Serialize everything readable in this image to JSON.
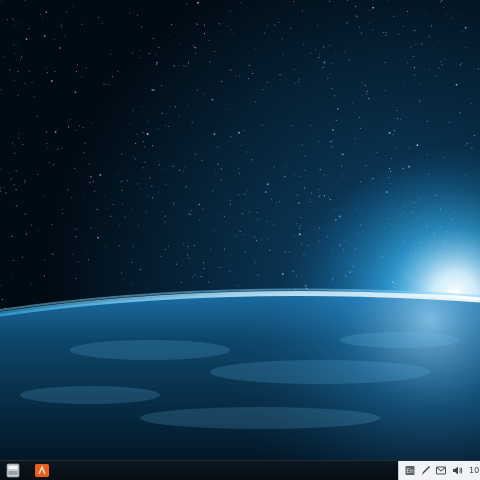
{
  "desktop": {
    "wallpaper": {
      "subject": "earth-horizon-starfield",
      "colors": {
        "space": "#010b14",
        "glow": "#d6f2ff",
        "atmosphere": "#1aa7e8",
        "planet": "#0b3555"
      }
    }
  },
  "taskbar": {
    "colors": {
      "background": "#0a131b",
      "tray_background": "#f2f3f4"
    },
    "launchers": [
      {
        "icon": "files-app-icon"
      },
      {
        "icon": "orange-app-icon",
        "accent": "#e8601e"
      }
    ],
    "tray": {
      "icons": [
        "keyboard-layout-icon",
        "pen-tool-icon",
        "message-icon",
        "volume-icon"
      ],
      "clock": "10"
    }
  }
}
